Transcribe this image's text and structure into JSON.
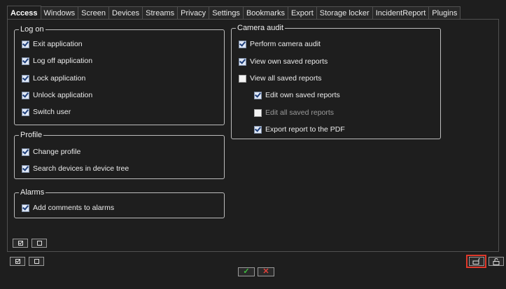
{
  "tabs": [
    {
      "label": "Access",
      "active": true
    },
    {
      "label": "Windows"
    },
    {
      "label": "Screen"
    },
    {
      "label": "Devices"
    },
    {
      "label": "Streams"
    },
    {
      "label": "Privacy"
    },
    {
      "label": "Settings"
    },
    {
      "label": "Bookmarks"
    },
    {
      "label": "Export"
    },
    {
      "label": "Storage locker"
    },
    {
      "label": "IncidentReport"
    },
    {
      "label": "Plugins"
    }
  ],
  "groups": {
    "log_on": {
      "title": "Log on",
      "items": [
        {
          "label": "Exit application",
          "checked": true
        },
        {
          "label": "Log off application",
          "checked": true
        },
        {
          "label": "Lock application",
          "checked": true
        },
        {
          "label": "Unlock application",
          "checked": true
        },
        {
          "label": "Switch user",
          "checked": true
        }
      ]
    },
    "profile": {
      "title": "Profile",
      "items": [
        {
          "label": "Change profile",
          "checked": true
        },
        {
          "label": "Search devices in device tree",
          "checked": true
        }
      ]
    },
    "alarms": {
      "title": "Alarms",
      "items": [
        {
          "label": "Add comments to alarms",
          "checked": true
        }
      ]
    },
    "camera_audit": {
      "title": "Camera audit",
      "items": [
        {
          "label": "Perform camera audit",
          "checked": true
        },
        {
          "label": "View own saved reports",
          "checked": true
        },
        {
          "label": "View all saved reports",
          "checked": false
        },
        {
          "label": "Edit own saved reports",
          "checked": true
        },
        {
          "label": "Edit all saved reports",
          "checked": false,
          "dim": true
        },
        {
          "label": "Export report to the PDF",
          "checked": true
        }
      ]
    }
  },
  "buttons": {
    "ok_symbol": "✓",
    "cancel_symbol": "✕"
  },
  "colors": {
    "background": "#1e1e1e",
    "ok": "#3fbf3f",
    "cancel": "#e0403a",
    "highlight": "#e0392b"
  }
}
